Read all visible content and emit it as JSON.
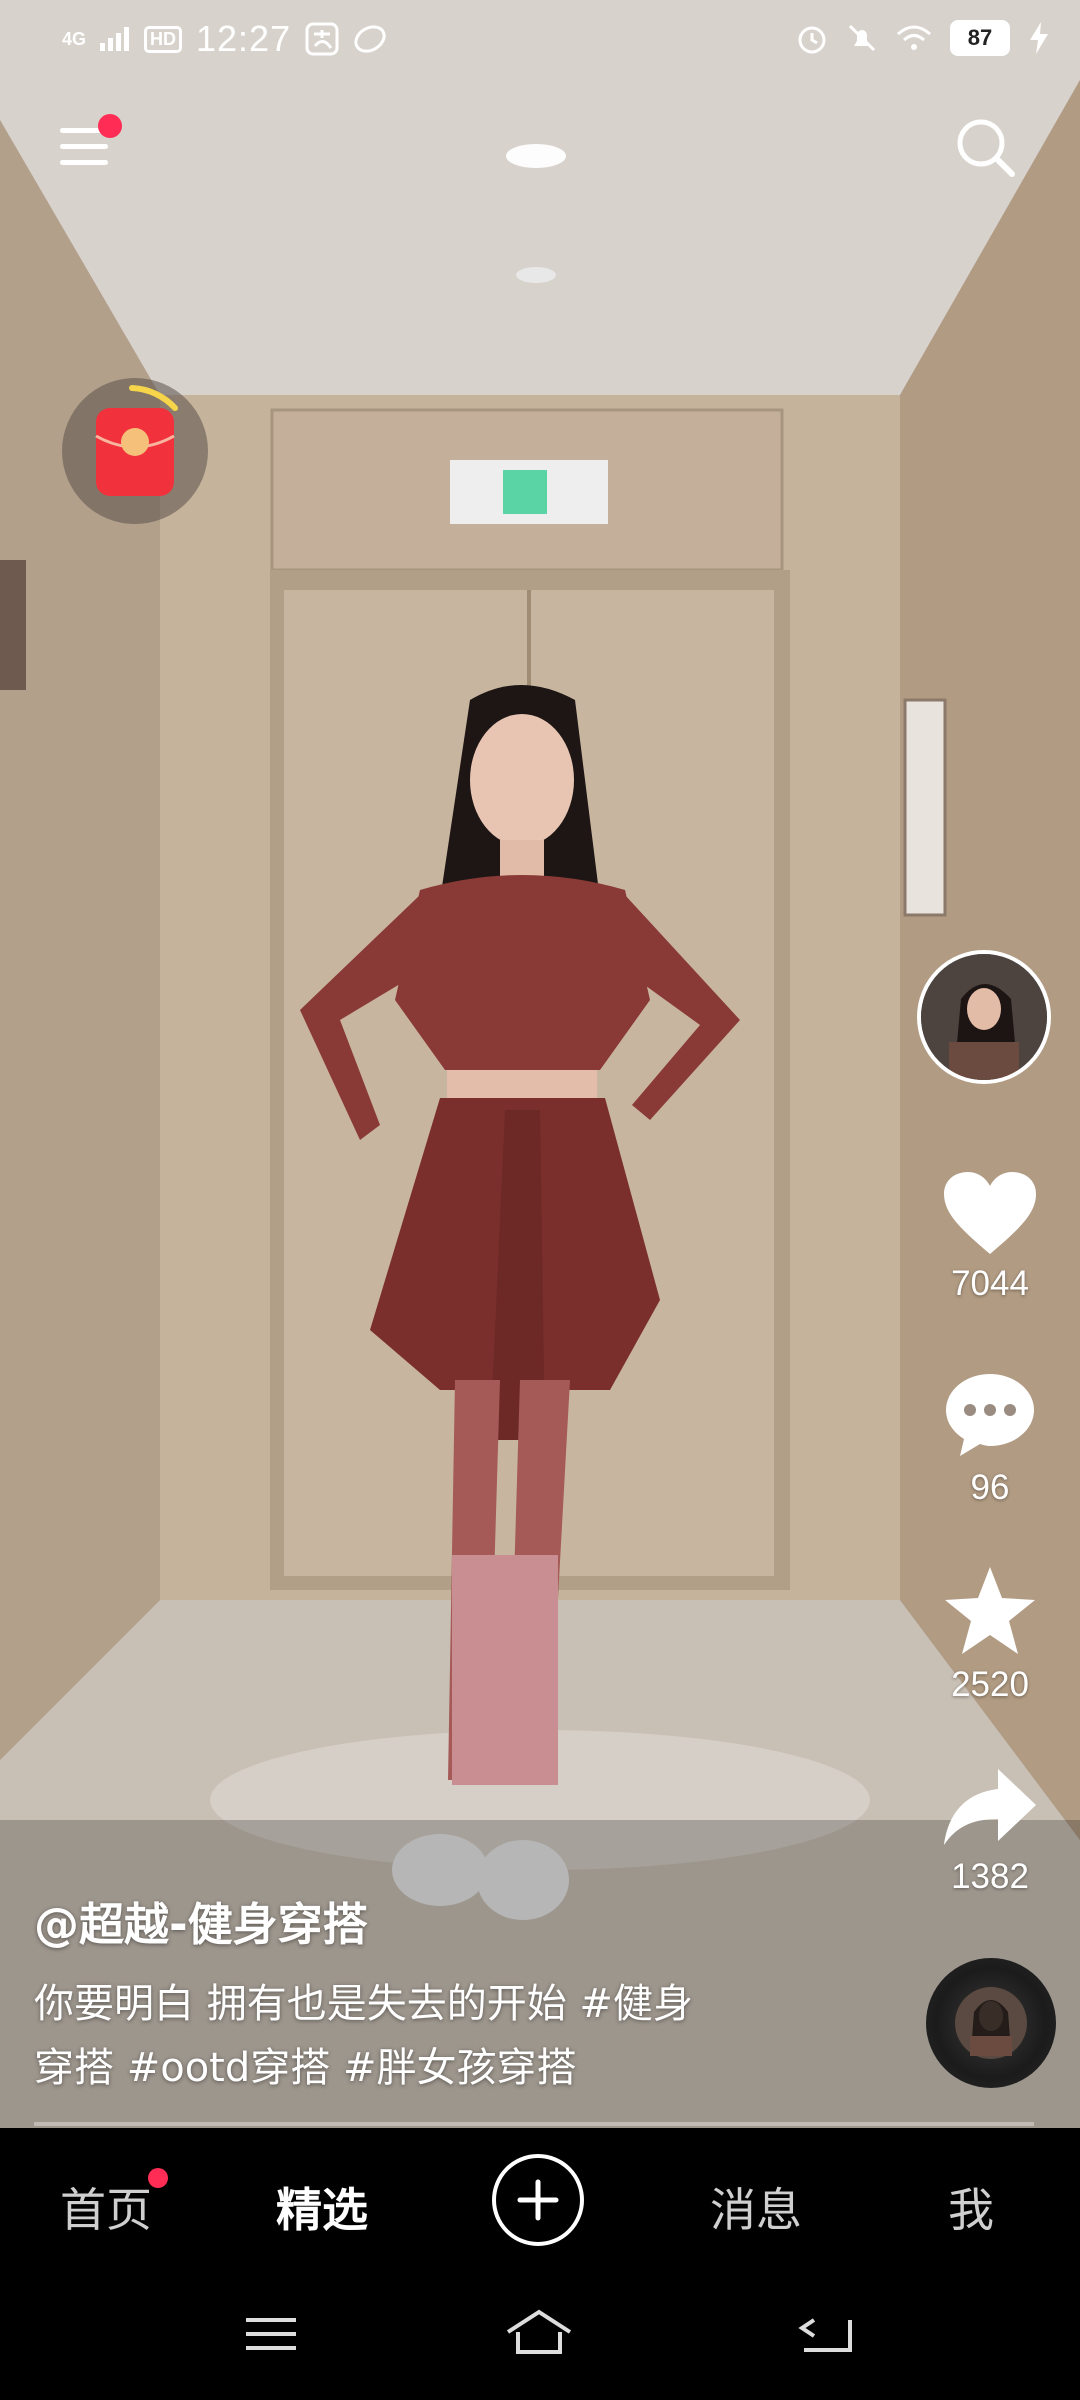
{
  "status_bar": {
    "network": "4G",
    "hd_label": "HD",
    "time": "12:27",
    "battery": "87"
  },
  "video": {
    "author": "@超越-健身穿搭",
    "description_line1": "你要明白 拥有也是失去的开始 #健身",
    "description_line2": "穿搭 #ootd穿搭 #胖女孩穿搭"
  },
  "actions": {
    "likes": "7044",
    "comments": "96",
    "favorites": "2520",
    "shares": "1382"
  },
  "tabs": {
    "home": "首页",
    "featured": "精选",
    "messages": "消息",
    "me": "我"
  },
  "colors": {
    "accent_dot": "#ff2d55",
    "tab_bar_bg": "#000000"
  },
  "icons": [
    "menu-icon",
    "search-icon",
    "red-packet-icon",
    "heart-icon",
    "comment-icon",
    "star-icon",
    "share-icon",
    "plus-icon",
    "recents-icon",
    "home-icon",
    "back-icon"
  ]
}
